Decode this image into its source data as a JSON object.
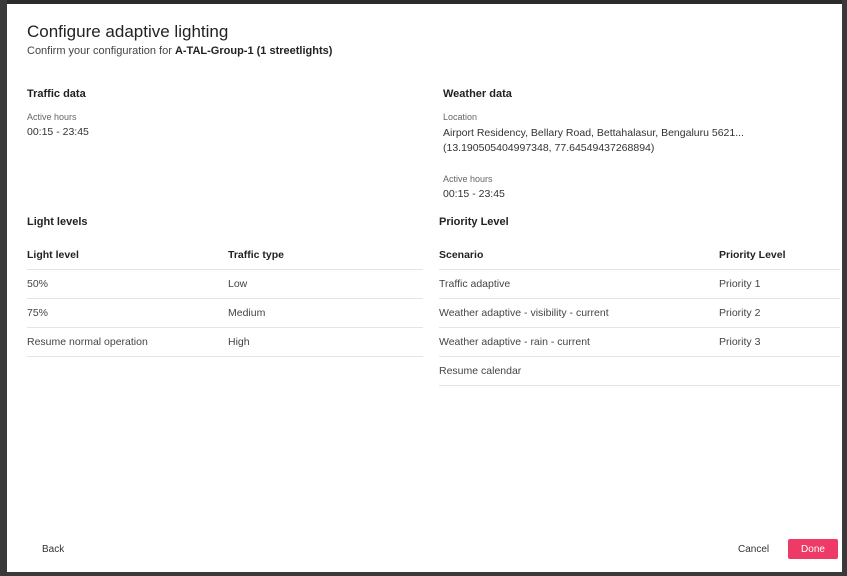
{
  "dialog": {
    "title": "Configure adaptive lighting",
    "subtitle_prefix": "Confirm your configuration for ",
    "subtitle_target": "A-TAL-Group-1 (1 streetlights)"
  },
  "traffic_data": {
    "heading": "Traffic data",
    "active_hours_label": "Active hours",
    "active_hours_value": "00:15 - 23:45"
  },
  "weather_data": {
    "heading": "Weather data",
    "location_label": "Location",
    "location_line1": "Airport Residency, Bellary Road, Bettahalasur, Bengaluru 5621...",
    "location_line2": "(13.190505404997348, 77.64549437268894)",
    "active_hours_label": "Active hours",
    "active_hours_value": "00:15 - 23:45"
  },
  "light_levels": {
    "heading": "Light levels",
    "columns": [
      "Light level",
      "Traffic type"
    ],
    "rows": [
      [
        "50%",
        "Low"
      ],
      [
        "75%",
        "Medium"
      ],
      [
        "Resume normal operation",
        "High"
      ]
    ]
  },
  "priority_level": {
    "heading": "Priority Level",
    "columns": [
      "Scenario",
      "Priority Level"
    ],
    "rows": [
      [
        "Traffic adaptive",
        "Priority 1"
      ],
      [
        "Weather adaptive - visibility - current",
        "Priority 2"
      ],
      [
        "Weather adaptive - rain - current",
        "Priority 3"
      ],
      [
        "Resume calendar",
        ""
      ]
    ]
  },
  "footer": {
    "back_label": "Back",
    "cancel_label": "Cancel",
    "done_label": "Done"
  },
  "colors": {
    "accent": "#ee3a66"
  }
}
